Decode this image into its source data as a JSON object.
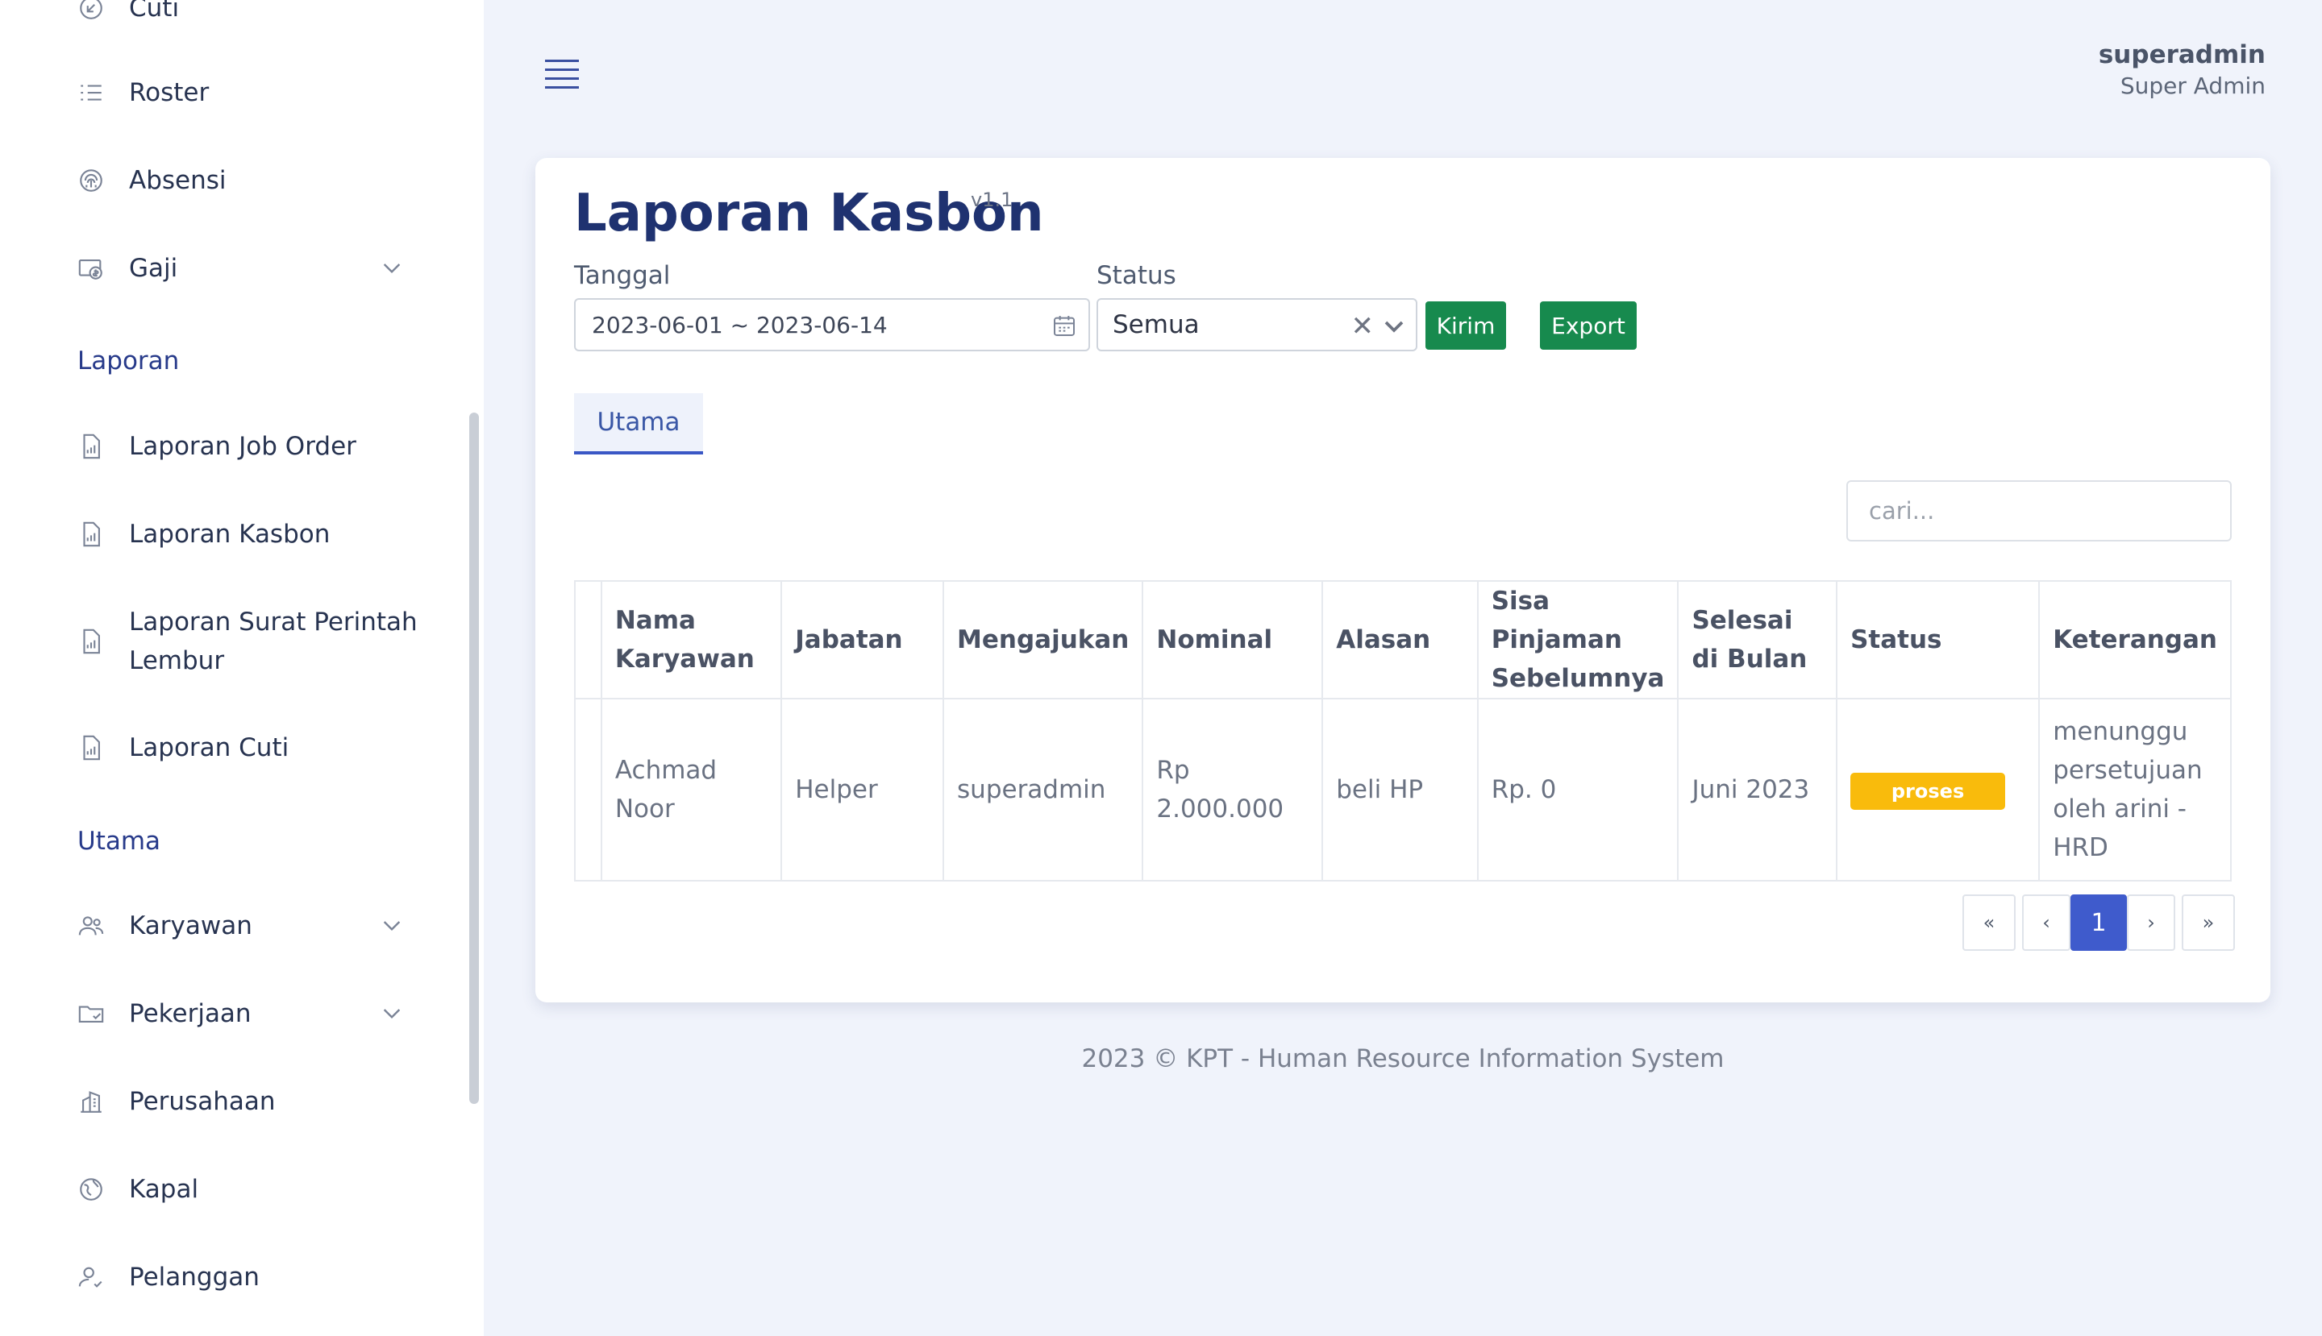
{
  "sidebar": {
    "items_top": [
      {
        "label": "Cuti",
        "icon": "logout-icon"
      },
      {
        "label": "Roster",
        "icon": "list-icon"
      },
      {
        "label": "Absensi",
        "icon": "fingerprint-icon"
      },
      {
        "label": "Gaji",
        "icon": "payroll-icon"
      }
    ],
    "section_laporan": "Laporan",
    "laporan_items": [
      {
        "label": "Laporan Job Order"
      },
      {
        "label": "Laporan Kasbon"
      },
      {
        "label": "Laporan Surat Perintah Lembur"
      },
      {
        "label": "Laporan Cuti"
      }
    ],
    "section_utama": "Utama",
    "utama_items": [
      {
        "label": "Karyawan"
      },
      {
        "label": "Pekerjaan"
      },
      {
        "label": "Perusahaan"
      },
      {
        "label": "Kapal"
      },
      {
        "label": "Pelanggan"
      }
    ]
  },
  "header": {
    "user_name": "superadmin",
    "user_role": "Super Admin"
  },
  "page": {
    "title": "Laporan Kasbon",
    "version": "v1.1",
    "filter": {
      "date_label": "Tanggal",
      "date_value": "2023-06-01 ~ 2023-06-14",
      "status_label": "Status",
      "status_value": "Semua",
      "send_button": "Kirim",
      "export_button": "Export"
    },
    "tab": "Utama",
    "search_placeholder": "cari...",
    "table": {
      "columns": [
        "",
        "Nama Karyawan",
        "Jabatan",
        "Mengajukan",
        "Nominal",
        "Alasan",
        "Sisa Pinjaman Sebelumnya",
        "Selesai di Bulan",
        "Status",
        "Keterangan"
      ],
      "rows": [
        {
          "nama": "Achmad Noor",
          "jabatan": "Helper",
          "mengajukan": "superadmin",
          "nominal": "Rp 2.000.000",
          "alasan": "beli HP",
          "sisa": "Rp. 0",
          "selesai": "Juni 2023",
          "status": "proses",
          "keterangan": "menunggu persetujuan oleh arini - HRD"
        }
      ]
    },
    "pagination": {
      "first": "«",
      "prev": "‹",
      "current": "1",
      "next": "›",
      "last": "»"
    }
  },
  "footer": "2023 © KPT - Human Resource Information System",
  "colors": {
    "primary": "#3f5bcc",
    "success": "#178a4e",
    "warning": "#f9bb0c",
    "background": "#f0f3fb"
  }
}
